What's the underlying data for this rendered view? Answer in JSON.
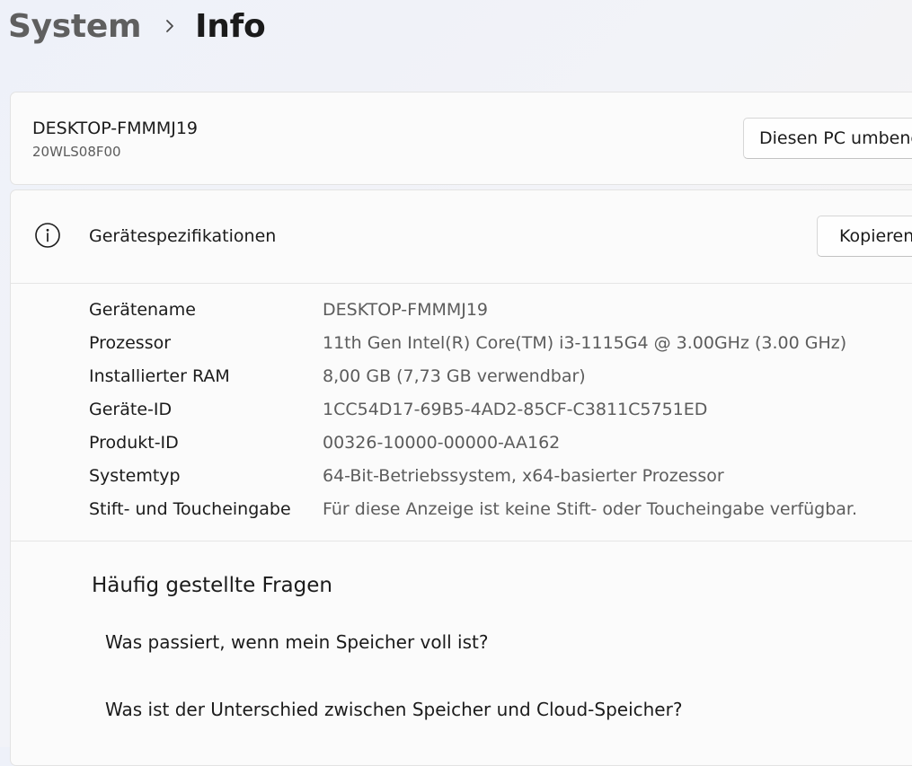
{
  "breadcrumb": {
    "parent": "System",
    "current": "Info"
  },
  "pc_card": {
    "device_name": "DESKTOP-FMMMJ19",
    "model": "20WLS08F00",
    "rename_button": "Diesen PC umbenennen"
  },
  "specs": {
    "title": "Gerätespezifikationen",
    "copy_button": "Kopieren",
    "icon": "info-icon",
    "rows": [
      {
        "label": "Gerätename",
        "value": "DESKTOP-FMMMJ19"
      },
      {
        "label": "Prozessor",
        "value": "11th Gen Intel(R) Core(TM) i3-1115G4 @ 3.00GHz (3.00 GHz)"
      },
      {
        "label": "Installierter RAM",
        "value": "8,00 GB (7,73 GB verwendbar)"
      },
      {
        "label": "Geräte-ID",
        "value": "1CC54D17-69B5-4AD2-85CF-C3811C5751ED"
      },
      {
        "label": "Produkt-ID",
        "value": "00326-10000-00000-AA162"
      },
      {
        "label": "Systemtyp",
        "value": "64-Bit-Betriebssystem, x64-basierter Prozessor"
      },
      {
        "label": "Stift- und Toucheingabe",
        "value": "Für diese Anzeige ist keine Stift- oder Toucheingabe verfügbar."
      }
    ]
  },
  "faq": {
    "title": "Häufig gestellte Fragen",
    "items": [
      "Was passiert, wenn mein Speicher voll ist?",
      "Was ist der Unterschied zwischen Speicher und Cloud-Speicher?"
    ]
  },
  "colors": {
    "text_primary": "#1b1b1b",
    "text_secondary": "#5c5c5c",
    "breadcrumb_parent": "#5f5f5f",
    "card_background": "#fbfbfb",
    "card_border": "#e3e3e3"
  }
}
